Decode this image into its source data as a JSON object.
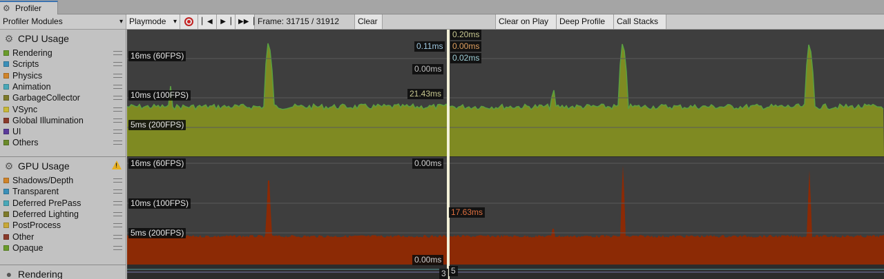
{
  "window": {
    "tab_title": "Profiler",
    "tab_icon": "profiler-icon"
  },
  "toolbar": {
    "modules_dropdown": "Profiler Modules",
    "target_dropdown": "Playmode",
    "record_icon": "record-icon",
    "prev_frame_icon": "step-back-icon",
    "next_frame_icon": "step-forward-icon",
    "last_frame_icon": "skip-to-end-icon",
    "frame_label": "Frame: 31715 / 31912",
    "clear": "Clear",
    "clear_on_play": "Clear on Play",
    "deep_profile": "Deep Profile",
    "call_stacks": "Call Stacks"
  },
  "modules": {
    "cpu": {
      "title": "CPU Usage",
      "icon": "cpu-icon",
      "legend": [
        {
          "label": "Rendering",
          "color": "#6a9b2a"
        },
        {
          "label": "Scripts",
          "color": "#3b8fb8"
        },
        {
          "label": "Physics",
          "color": "#d0842a"
        },
        {
          "label": "Animation",
          "color": "#4aa8b8"
        },
        {
          "label": "GarbageCollector",
          "color": "#7d7a2a"
        },
        {
          "label": "VSync",
          "color": "#c8b838"
        },
        {
          "label": "Global Illumination",
          "color": "#8a3a2a"
        },
        {
          "label": "UI",
          "color": "#5a3a9a"
        },
        {
          "label": "Others",
          "color": "#6a8a2a"
        }
      ],
      "thresholds": [
        "16ms (60FPS)",
        "10ms (100FPS)",
        "5ms (200FPS)"
      ],
      "cursor_labels": {
        "ms020": "0.20ms",
        "ms011": "0.11ms",
        "ms000a": "0.00ms",
        "ms002": "0.02ms",
        "ms000b": "0.00ms",
        "ms2143": "21.43ms"
      }
    },
    "gpu": {
      "title": "GPU Usage",
      "icon": "gpu-icon",
      "warning_icon": "warning-icon",
      "legend": [
        {
          "label": "Shadows/Depth",
          "color": "#d0842a"
        },
        {
          "label": "Transparent",
          "color": "#3b8fb8"
        },
        {
          "label": "Deferred PrePass",
          "color": "#4aa8b8"
        },
        {
          "label": "Deferred Lighting",
          "color": "#7d7a2a"
        },
        {
          "label": "PostProcess",
          "color": "#c8a838"
        },
        {
          "label": "Other",
          "color": "#8a3a2a"
        },
        {
          "label": "Opaque",
          "color": "#6a9b2a"
        }
      ],
      "thresholds": [
        "16ms (60FPS)",
        "10ms (100FPS)",
        "5ms (200FPS)"
      ],
      "cursor_labels": {
        "top": "0.00ms",
        "mid": "17.63ms",
        "bottom": "0.00ms"
      }
    },
    "rendering": {
      "title": "Rendering",
      "icon": "rendering-icon",
      "cursor_labels": {
        "left": "3",
        "right": "5"
      }
    }
  },
  "colors": {
    "chart_bg": "#3e3e3e",
    "cpu_fill": "#7f8a22",
    "cpu_top": "#5aa040",
    "gpu_fill": "#8c2a05",
    "cursor": "#f2f0d8",
    "label_green": "#9fd060",
    "label_orange": "#e07040"
  }
}
